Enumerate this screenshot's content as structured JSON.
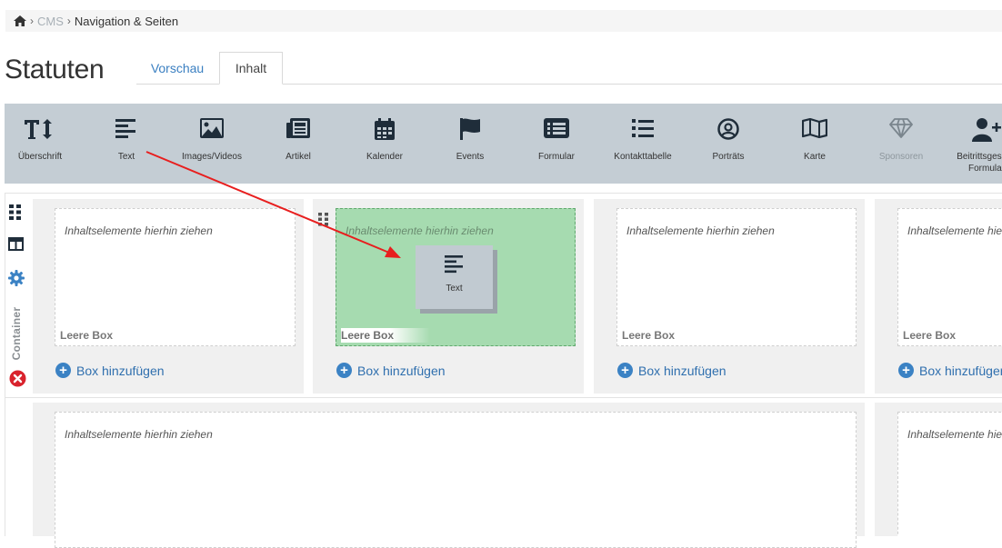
{
  "breadcrumb": {
    "items": [
      "CMS",
      "Navigation & Seiten"
    ]
  },
  "page": {
    "title": "Statuten"
  },
  "tabs": [
    {
      "label": "Vorschau"
    },
    {
      "label": "Inhalt"
    }
  ],
  "toolbar": {
    "items": [
      {
        "label": "Überschrift",
        "icon": "heading-icon"
      },
      {
        "label": "Text",
        "icon": "text-align-left-icon"
      },
      {
        "label": "Images/Videos",
        "icon": "image-icon"
      },
      {
        "label": "Artikel",
        "icon": "newspaper-icon"
      },
      {
        "label": "Kalender",
        "icon": "calendar-icon"
      },
      {
        "label": "Events",
        "icon": "flag-icon"
      },
      {
        "label": "Formular",
        "icon": "form-icon"
      },
      {
        "label": "Kontakttabelle",
        "icon": "list-icon"
      },
      {
        "label": "Porträts",
        "icon": "user-circle-icon"
      },
      {
        "label": "Karte",
        "icon": "map-icon"
      },
      {
        "label": "Sponsoren",
        "icon": "diamond-icon",
        "disabled": true
      },
      {
        "label": "Beitrittsgesuch",
        "label2": "Formular",
        "icon": "user-plus-icon"
      }
    ]
  },
  "container": {
    "label": "Container"
  },
  "boxes": {
    "hint": "Inhaltselemente hierhin ziehen",
    "empty": "Leere Box",
    "add": "Box hinzufügen"
  },
  "drag_ghost": {
    "label": "Text"
  },
  "colors": {
    "accent": "#3b82c4",
    "toolbar": "#c4cdd4",
    "drop_highlight": "#a6dbb0",
    "delete": "#d9232d"
  }
}
